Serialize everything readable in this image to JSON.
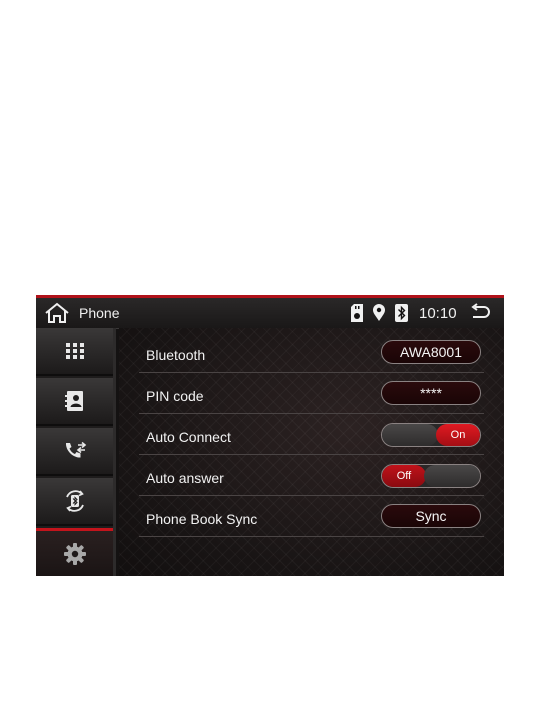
{
  "statusbar": {
    "title": "Phone",
    "time": "10:10",
    "icons": [
      "home-icon",
      "sd-card-icon",
      "location-icon",
      "bluetooth-icon",
      "back-icon"
    ]
  },
  "sidebar": {
    "items": [
      {
        "icon": "apps-grid-icon"
      },
      {
        "icon": "contacts-icon"
      },
      {
        "icon": "call-log-icon"
      },
      {
        "icon": "bluetooth-phone-icon"
      },
      {
        "icon": "settings-icon",
        "active": true
      }
    ]
  },
  "settings": {
    "bluetooth": {
      "label": "Bluetooth",
      "value": "AWA8001"
    },
    "pin_code": {
      "label": "PIN code",
      "value": "****"
    },
    "auto_connect": {
      "label": "Auto Connect",
      "state": "On"
    },
    "auto_answer": {
      "label": "Auto answer",
      "state": "Off"
    },
    "phone_book_sync": {
      "label": "Phone Book Sync",
      "button": "Sync"
    }
  },
  "colors": {
    "accent": "#c4141c",
    "background": "#141212",
    "text": "#f2f2f2"
  }
}
